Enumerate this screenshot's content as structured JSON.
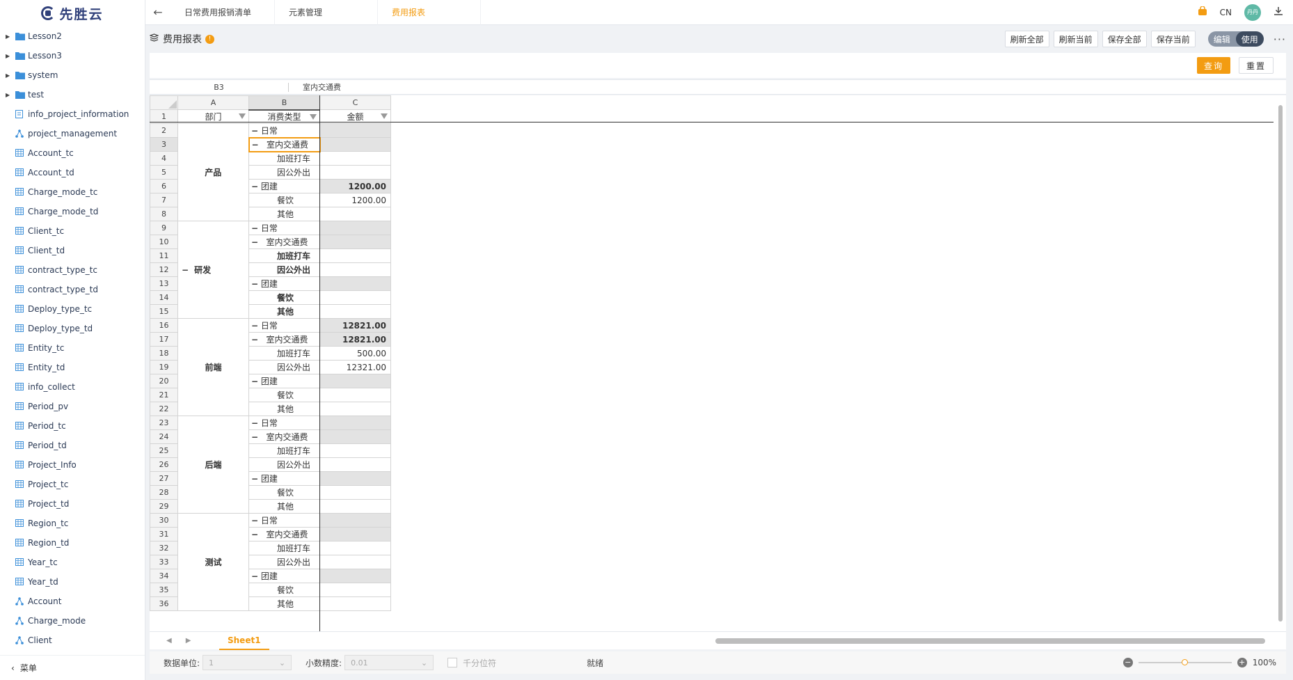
{
  "brand": {
    "name": "先胜云"
  },
  "sidebar": {
    "items": [
      {
        "label": "Lesson2",
        "type": "folder"
      },
      {
        "label": "Lesson3",
        "type": "folder"
      },
      {
        "label": "system",
        "type": "folder"
      },
      {
        "label": "test",
        "type": "folder"
      },
      {
        "label": "info_project_information",
        "type": "form"
      },
      {
        "label": "project_management",
        "type": "tree"
      },
      {
        "label": "Account_tc",
        "type": "table"
      },
      {
        "label": "Account_td",
        "type": "table"
      },
      {
        "label": "Charge_mode_tc",
        "type": "table"
      },
      {
        "label": "Charge_mode_td",
        "type": "table"
      },
      {
        "label": "Client_tc",
        "type": "table"
      },
      {
        "label": "Client_td",
        "type": "table"
      },
      {
        "label": "contract_type_tc",
        "type": "table"
      },
      {
        "label": "contract_type_td",
        "type": "table"
      },
      {
        "label": "Deploy_type_tc",
        "type": "table"
      },
      {
        "label": "Deploy_type_td",
        "type": "table"
      },
      {
        "label": "Entity_tc",
        "type": "table"
      },
      {
        "label": "Entity_td",
        "type": "table"
      },
      {
        "label": "info_collect",
        "type": "table"
      },
      {
        "label": "Period_pv",
        "type": "table"
      },
      {
        "label": "Period_tc",
        "type": "table"
      },
      {
        "label": "Period_td",
        "type": "table"
      },
      {
        "label": "Project_Info",
        "type": "table"
      },
      {
        "label": "Project_tc",
        "type": "table"
      },
      {
        "label": "Project_td",
        "type": "table"
      },
      {
        "label": "Region_tc",
        "type": "table"
      },
      {
        "label": "Region_td",
        "type": "table"
      },
      {
        "label": "Year_tc",
        "type": "table"
      },
      {
        "label": "Year_td",
        "type": "table"
      },
      {
        "label": "Account",
        "type": "tree"
      },
      {
        "label": "Charge_mode",
        "type": "tree"
      },
      {
        "label": "Client",
        "type": "tree"
      }
    ],
    "footer_label": "菜单"
  },
  "topbar": {
    "tabs": [
      {
        "label": "日常费用报销清单"
      },
      {
        "label": "元素管理"
      },
      {
        "label": "费用报表"
      }
    ],
    "lang": "CN",
    "avatar": "丹丹"
  },
  "report": {
    "title": "费用报表",
    "actions": [
      "刷新全部",
      "刷新当前",
      "保存全部",
      "保存当前"
    ],
    "mode_edit": "编辑",
    "mode_use": "使用",
    "query": "查询",
    "reset": "重置"
  },
  "formula_bar": {
    "cell_ref": "B3",
    "cell_value": "室内交通费"
  },
  "grid": {
    "columns": [
      "A",
      "B",
      "C"
    ],
    "headers": [
      "部门",
      "消费类型",
      "金额"
    ],
    "departments": [
      {
        "name": "产品",
        "rows": [
          2,
          8
        ],
        "collapsible": false
      },
      {
        "name": "研发",
        "rows": [
          9,
          15
        ],
        "collapsible": true
      },
      {
        "name": "前端",
        "rows": [
          16,
          22
        ],
        "collapsible": false
      },
      {
        "name": "后端",
        "rows": [
          23,
          29
        ],
        "collapsible": false
      },
      {
        "name": "测试",
        "rows": [
          30,
          36
        ],
        "collapsible": false
      }
    ],
    "rows": [
      {
        "n": 2,
        "cat": "日常",
        "level": 1,
        "amount": "",
        "shade": true
      },
      {
        "n": 3,
        "cat": "室内交通费",
        "level": 2,
        "amount": "",
        "shade": true,
        "selected": true
      },
      {
        "n": 4,
        "cat": "加班打车",
        "level": 3,
        "amount": ""
      },
      {
        "n": 5,
        "cat": "因公外出",
        "level": 3,
        "amount": ""
      },
      {
        "n": 6,
        "cat": "团建",
        "level": 1,
        "amount": "1200.00",
        "shade": true,
        "bold_amount": true
      },
      {
        "n": 7,
        "cat": "餐饮",
        "level": 3,
        "amount": "1200.00"
      },
      {
        "n": 8,
        "cat": "其他",
        "level": 3,
        "amount": ""
      },
      {
        "n": 9,
        "cat": "日常",
        "level": 1,
        "amount": "",
        "shade": true
      },
      {
        "n": 10,
        "cat": "室内交通费",
        "level": 2,
        "amount": "",
        "shade": true
      },
      {
        "n": 11,
        "cat": "加班打车",
        "level": 3,
        "amount": "",
        "bold": true
      },
      {
        "n": 12,
        "cat": "因公外出",
        "level": 3,
        "amount": "",
        "bold": true
      },
      {
        "n": 13,
        "cat": "团建",
        "level": 1,
        "amount": "",
        "shade": true
      },
      {
        "n": 14,
        "cat": "餐饮",
        "level": 3,
        "amount": "",
        "bold": true
      },
      {
        "n": 15,
        "cat": "其他",
        "level": 3,
        "amount": "",
        "bold": true
      },
      {
        "n": 16,
        "cat": "日常",
        "level": 1,
        "amount": "12821.00",
        "shade": true,
        "bold_amount": true
      },
      {
        "n": 17,
        "cat": "室内交通费",
        "level": 2,
        "amount": "12821.00",
        "shade": true,
        "bold_amount": true
      },
      {
        "n": 18,
        "cat": "加班打车",
        "level": 3,
        "amount": "500.00"
      },
      {
        "n": 19,
        "cat": "因公外出",
        "level": 3,
        "amount": "12321.00"
      },
      {
        "n": 20,
        "cat": "团建",
        "level": 1,
        "amount": "",
        "shade": true
      },
      {
        "n": 21,
        "cat": "餐饮",
        "level": 3,
        "amount": ""
      },
      {
        "n": 22,
        "cat": "其他",
        "level": 3,
        "amount": ""
      },
      {
        "n": 23,
        "cat": "日常",
        "level": 1,
        "amount": "",
        "shade": true
      },
      {
        "n": 24,
        "cat": "室内交通费",
        "level": 2,
        "amount": "",
        "shade": true
      },
      {
        "n": 25,
        "cat": "加班打车",
        "level": 3,
        "amount": ""
      },
      {
        "n": 26,
        "cat": "因公外出",
        "level": 3,
        "amount": ""
      },
      {
        "n": 27,
        "cat": "团建",
        "level": 1,
        "amount": "",
        "shade": true
      },
      {
        "n": 28,
        "cat": "餐饮",
        "level": 3,
        "amount": ""
      },
      {
        "n": 29,
        "cat": "其他",
        "level": 3,
        "amount": ""
      },
      {
        "n": 30,
        "cat": "日常",
        "level": 1,
        "amount": "",
        "shade": true
      },
      {
        "n": 31,
        "cat": "室内交通费",
        "level": 2,
        "amount": "",
        "shade": true
      },
      {
        "n": 32,
        "cat": "加班打车",
        "level": 3,
        "amount": ""
      },
      {
        "n": 33,
        "cat": "因公外出",
        "level": 3,
        "amount": ""
      },
      {
        "n": 34,
        "cat": "团建",
        "level": 1,
        "amount": "",
        "shade": true
      },
      {
        "n": 35,
        "cat": "餐饮",
        "level": 3,
        "amount": ""
      },
      {
        "n": 36,
        "cat": "其他",
        "level": 3,
        "amount": ""
      }
    ]
  },
  "sheet_tabs": {
    "active": "Sheet1"
  },
  "status_bar": {
    "unit_label": "数据单位:",
    "unit_value": "1",
    "precision_label": "小数精度:",
    "precision_value": "0.01",
    "thousands_label": "千分位符",
    "status": "就绪",
    "zoom": "100%",
    "zoom_level": 0.5
  },
  "colors": {
    "accent": "#f39c12",
    "brand": "#30407a"
  }
}
